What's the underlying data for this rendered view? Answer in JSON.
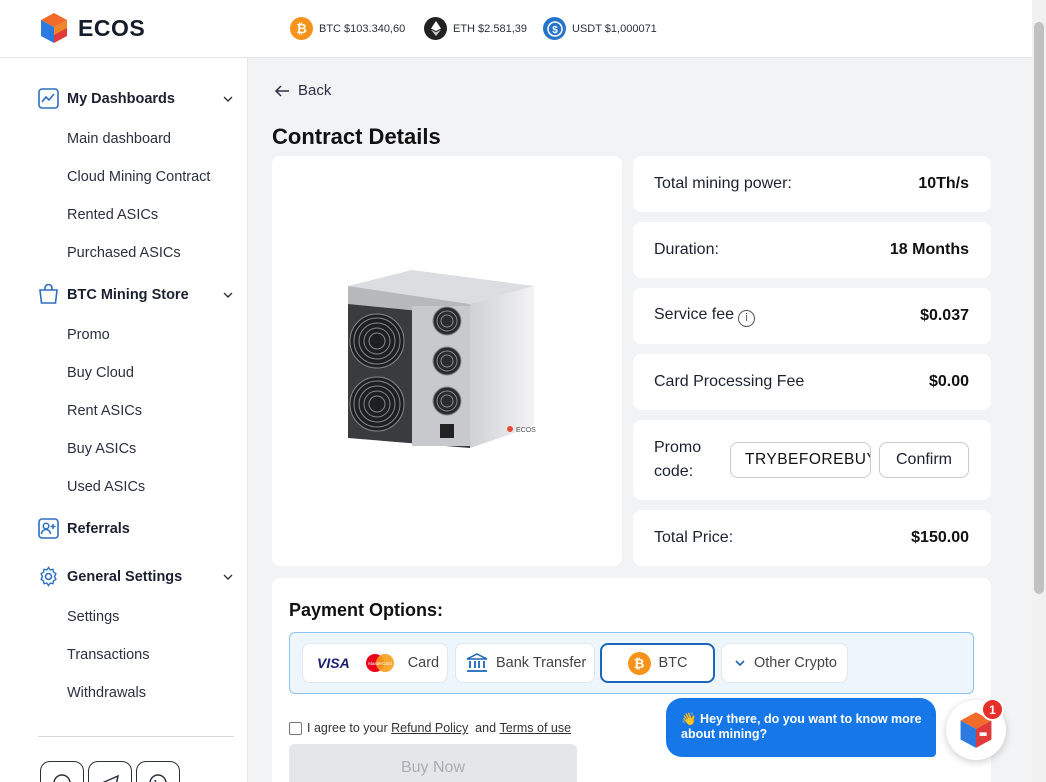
{
  "header": {
    "logo_text": "ECOS",
    "tickers": [
      {
        "label": "BTC $103.340,60",
        "icon": "bitcoin-icon",
        "color": "#f7931a"
      },
      {
        "label": "ETH $2.581,39",
        "icon": "ethereum-icon",
        "color": "#222"
      },
      {
        "label": "USDT $1,000071",
        "icon": "usdt-icon",
        "color": "#2775ca"
      }
    ]
  },
  "sidebar": {
    "sections": [
      {
        "label": "My Dashboards",
        "icon": "chart-icon",
        "items": [
          "Main dashboard",
          "Cloud Mining Contract",
          "Rented ASICs",
          "Purchased ASICs"
        ]
      },
      {
        "label": "BTC Mining Store",
        "icon": "shopping-bag-icon",
        "items": [
          "Promo",
          "Buy Cloud",
          "Rent ASICs",
          "Buy ASICs",
          "Used ASICs"
        ]
      },
      {
        "label": "Referrals",
        "icon": "add-user-icon",
        "items": []
      },
      {
        "label": "General Settings",
        "icon": "gear-icon",
        "items": [
          "Settings",
          "Transactions",
          "Withdrawals"
        ]
      }
    ]
  },
  "main": {
    "back_label": "Back",
    "title": "Contract Details",
    "product_brand": "ECOS",
    "details": {
      "mining_power_label": "Total mining power:",
      "mining_power_value": "10Th/s",
      "duration_label": "Duration:",
      "duration_value": "18 Months",
      "service_fee_label": "Service fee",
      "service_fee_value": "$0.037",
      "card_fee_label": "Card Processing Fee",
      "card_fee_value": "$0.00",
      "promo_label": "Promo code:",
      "promo_value": "TRYBEFOREBUY",
      "confirm_label": "Confirm",
      "total_label": "Total Price:",
      "total_value": "$150.00"
    },
    "payment": {
      "title": "Payment Options:",
      "visa": "VISA",
      "mastercard": "MasterCard",
      "card_label": "Card",
      "bank_label": "Bank Transfer",
      "btc_label": "BTC",
      "other_label": "Other Crypto",
      "selected": "BTC"
    },
    "agree": {
      "prefix": "I agree to your",
      "refund_link": "Refund Policy",
      "and": "and",
      "terms_link": "Terms of use"
    },
    "buy_label": "Buy Now"
  },
  "chat": {
    "message": "👋 Hey there, do you want to know more about mining?",
    "badge_count": "1"
  }
}
